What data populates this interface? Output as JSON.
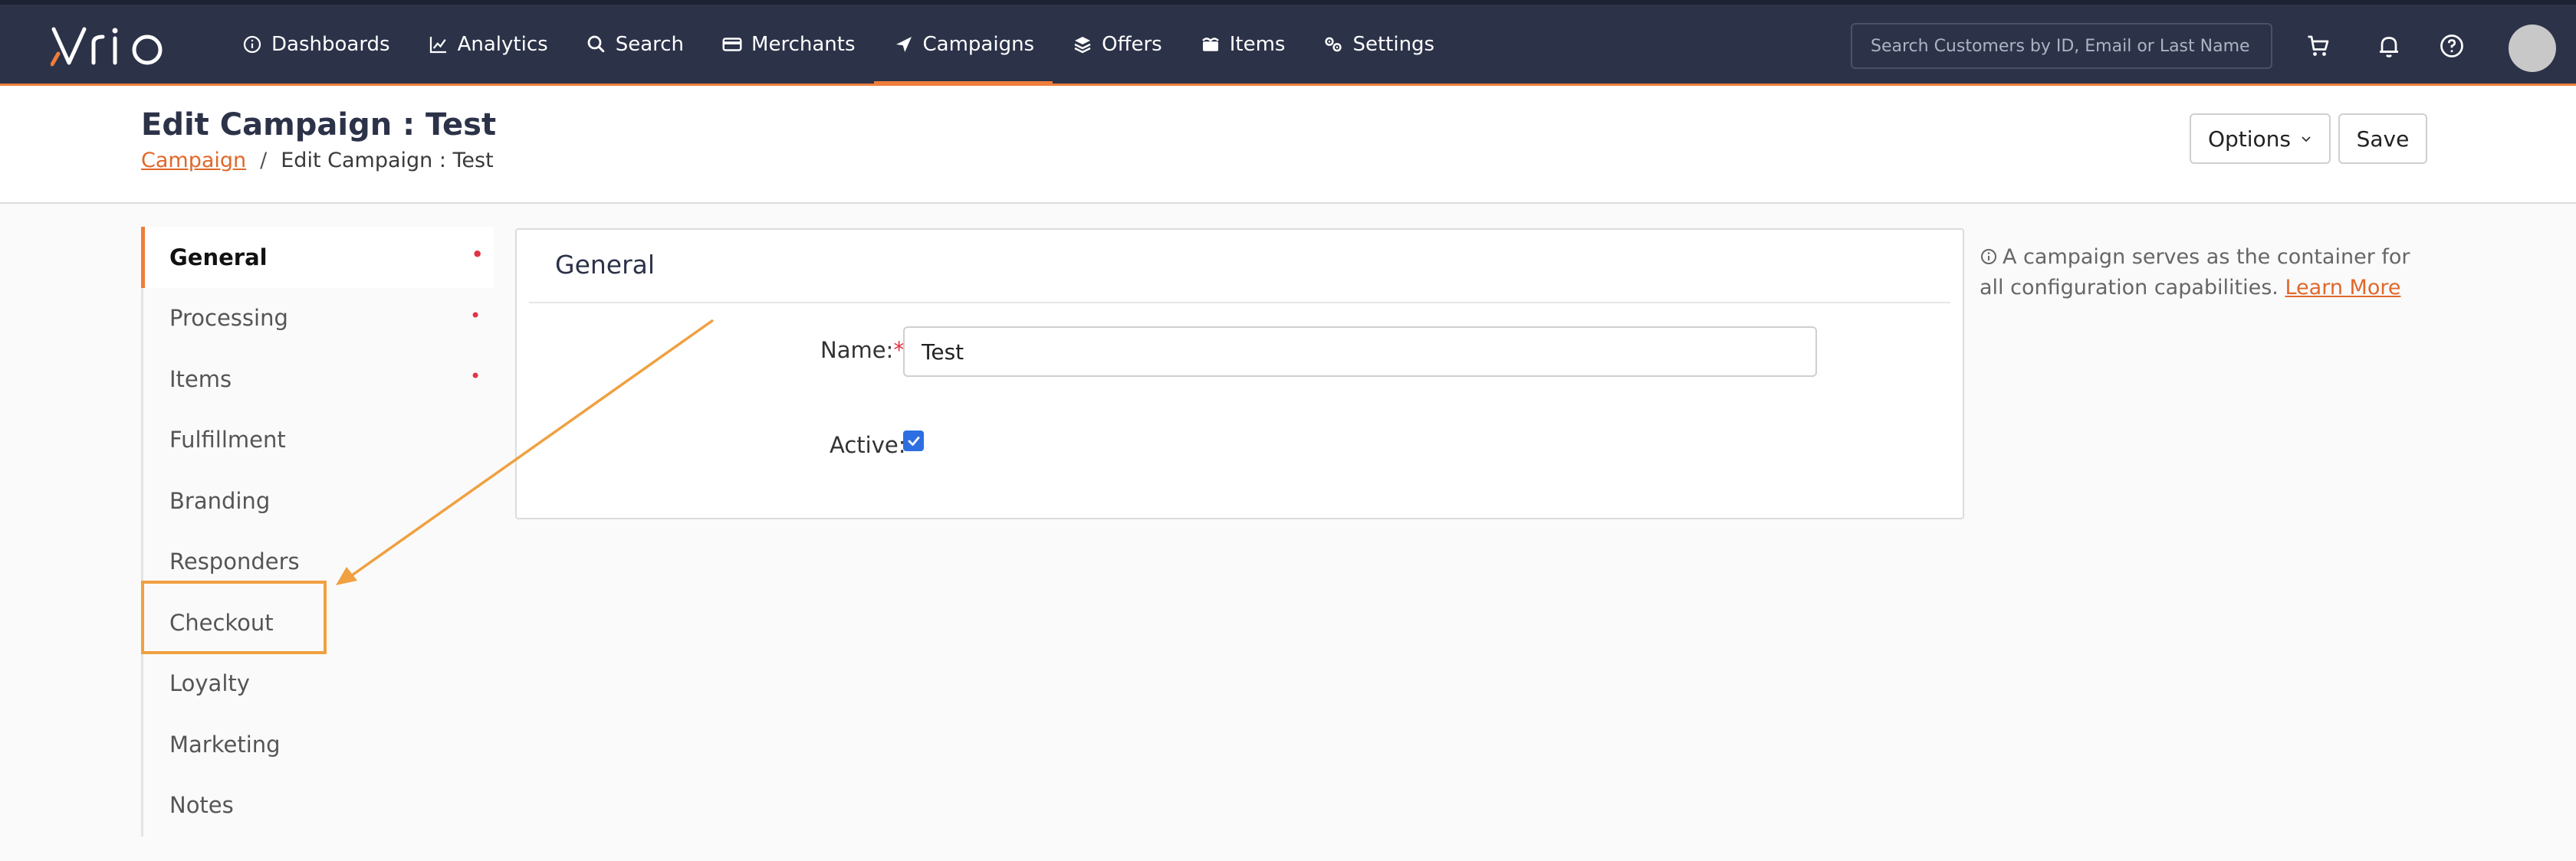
{
  "brand": {
    "logo_text": "Vrio",
    "accent_color": "#ef7d3a",
    "nav_bg": "#2c3248"
  },
  "nav": {
    "items": [
      {
        "label": "Dashboards",
        "icon": "info-circle-icon"
      },
      {
        "label": "Analytics",
        "icon": "line-chart-icon"
      },
      {
        "label": "Search",
        "icon": "search-icon"
      },
      {
        "label": "Merchants",
        "icon": "credit-card-icon"
      },
      {
        "label": "Campaigns",
        "icon": "send-arrow-icon",
        "active": true
      },
      {
        "label": "Offers",
        "icon": "layers-icon"
      },
      {
        "label": "Items",
        "icon": "box-icon"
      },
      {
        "label": "Settings",
        "icon": "gears-icon"
      }
    ],
    "search_placeholder": "Search Customers by ID, Email or Last Name",
    "icons": [
      "cart-icon",
      "bell-icon",
      "help-icon",
      "avatar"
    ]
  },
  "header": {
    "title": "Edit Campaign : Test",
    "breadcrumb": {
      "link": "Campaign",
      "separator": "/",
      "current": "Edit Campaign : Test"
    },
    "options_label": "Options",
    "save_label": "Save"
  },
  "sidebar": {
    "items": [
      {
        "label": "General",
        "required": true,
        "active": true
      },
      {
        "label": "Processing",
        "required": true
      },
      {
        "label": "Items",
        "required": true
      },
      {
        "label": "Fulfillment"
      },
      {
        "label": "Branding"
      },
      {
        "label": "Responders"
      },
      {
        "label": "Checkout",
        "highlighted": true
      },
      {
        "label": "Loyalty"
      },
      {
        "label": "Marketing"
      },
      {
        "label": "Notes"
      }
    ],
    "required_marker": "•"
  },
  "general": {
    "title": "General",
    "name_label": "Name:",
    "name_required": "*",
    "name_value": "Test",
    "active_label": "Active:",
    "active_checked": true
  },
  "info": {
    "text": "A campaign serves as the container for all configuration capabilities.",
    "link": "Learn More"
  },
  "annotation": {
    "color": "#f0a040"
  }
}
